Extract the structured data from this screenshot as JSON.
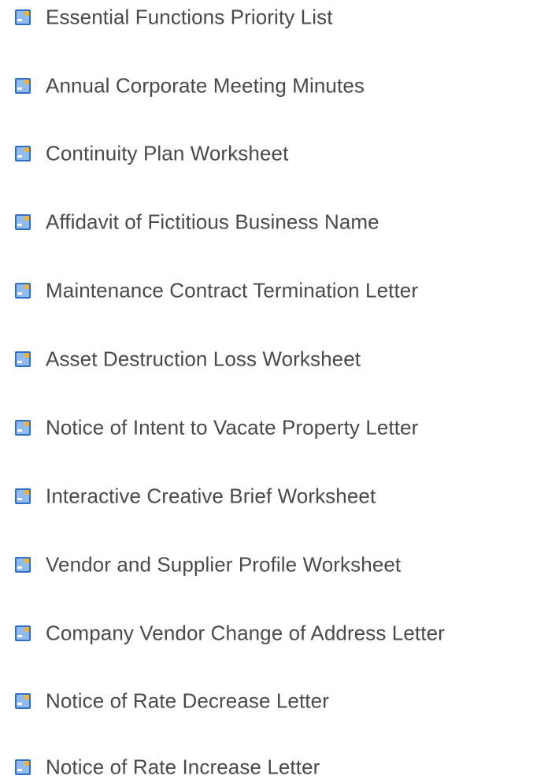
{
  "documents": {
    "icon": "document-icon",
    "icon_colors": {
      "dark": "#2f6fc7",
      "light": "#8fbcec",
      "highlight": "#ffffff",
      "accent": "#f2b233"
    },
    "text_color": "#4a4a4a",
    "items": [
      {
        "label": "Essential Functions Priority List"
      },
      {
        "label": "Annual Corporate Meeting Minutes"
      },
      {
        "label": "Continuity Plan Worksheet"
      },
      {
        "label": "Affidavit of Fictitious Business Name"
      },
      {
        "label": "Maintenance Contract Termination Letter"
      },
      {
        "label": "Asset Destruction Loss Worksheet"
      },
      {
        "label": "Notice of Intent to Vacate Property Letter"
      },
      {
        "label": "Interactive Creative Brief Worksheet"
      },
      {
        "label": "Vendor and Supplier Profile Worksheet"
      },
      {
        "label": "Company Vendor Change of Address Letter"
      },
      {
        "label": "Notice of Rate Decrease Letter"
      },
      {
        "label": "Notice of Rate Increase Letter"
      }
    ]
  }
}
